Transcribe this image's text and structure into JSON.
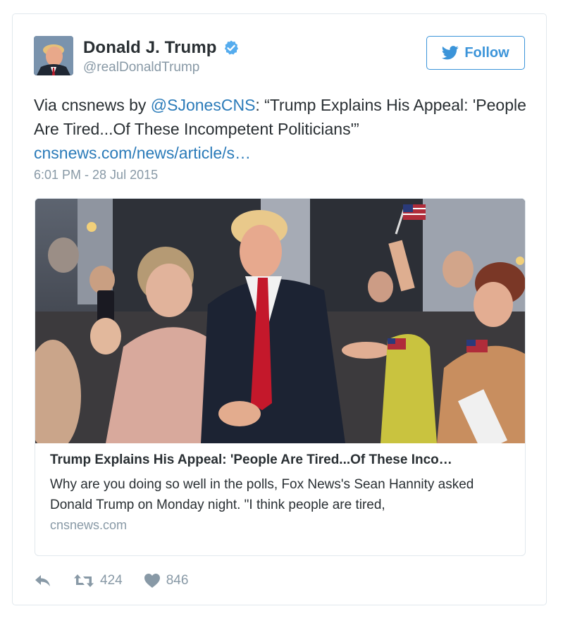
{
  "user": {
    "full_name": "Donald J. Trump",
    "handle": "@realDonaldTrump",
    "verified": true
  },
  "follow_button": {
    "label": "Follow"
  },
  "tweet": {
    "text_prefix": "Via cnsnews by ",
    "mention": "@SJonesCNS",
    "text_quote": ": “Trump Explains His Appeal: 'People Are Tired...Of These Incompetent Politicians'”",
    "link": "cnsnews.com/news/article/s…",
    "timestamp": "6:01 PM - 28 Jul 2015"
  },
  "card": {
    "title": "Trump Explains His Appeal: 'People Are Tired...Of These Inco…",
    "description": "Why are you doing so well in the polls, Fox News's Sean Hannity asked Donald Trump on Monday night. \"I think people are tired,",
    "domain": "cnsnews.com"
  },
  "actions": {
    "retweets": "424",
    "likes": "846"
  },
  "colors": {
    "link_blue": "#2b7bb9",
    "follow_blue": "#3b94d9",
    "verified_blue": "#55acee",
    "muted_gray": "#8899a6",
    "text_dark": "#292f33"
  }
}
